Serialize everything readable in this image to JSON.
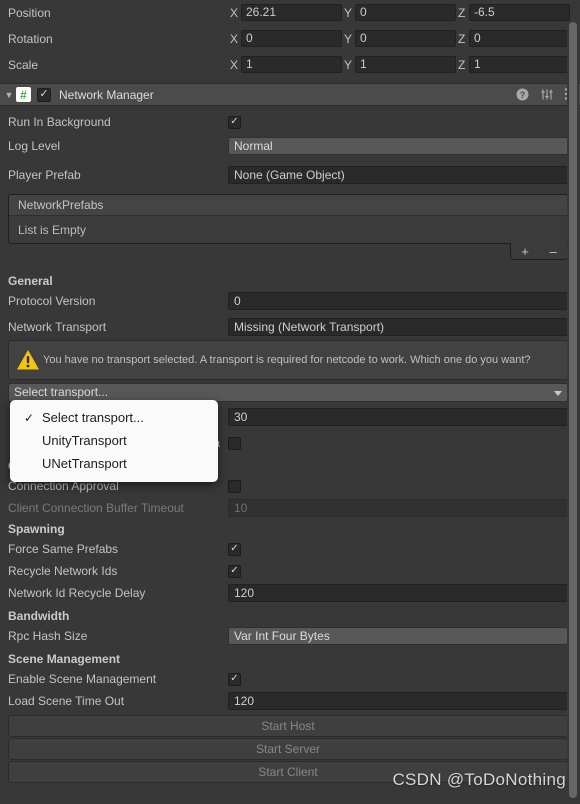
{
  "transform": {
    "rows": [
      {
        "label": "Position",
        "x": "26.21",
        "y": "0",
        "z": "-6.5"
      },
      {
        "label": "Rotation",
        "x": "0",
        "y": "0",
        "z": "0"
      },
      {
        "label": "Scale",
        "x": "1",
        "y": "1",
        "z": "1"
      }
    ],
    "axis_x": "X",
    "axis_y": "Y",
    "axis_z": "Z"
  },
  "component": {
    "title": "Network Manager",
    "script_icon_glyph": "#",
    "enabled_check": "✓",
    "foldout_glyph": "▼",
    "help_icon": "help-icon",
    "preset_icon": "preset-icon",
    "menu_icon": "more-menu-icon"
  },
  "fields": {
    "run_in_background": {
      "label": "Run In Background",
      "checked": true,
      "check": "✓"
    },
    "log_level": {
      "label": "Log Level",
      "value": "Normal"
    },
    "player_prefab": {
      "label": "Player Prefab",
      "value": "None (Game Object)"
    }
  },
  "network_prefabs_list": {
    "header": "NetworkPrefabs",
    "empty_text": "List is Empty",
    "add_label": "+",
    "remove_label": "–"
  },
  "general": {
    "title": "General",
    "protocol_version": {
      "label": "Protocol Version",
      "value": "0"
    },
    "network_transport": {
      "label": "Network Transport",
      "value": "Missing (Network Transport)"
    },
    "warning": "You have no transport selected. A transport is required for netcode to work. Which one do you want?",
    "select_transport_label": "Select transport...",
    "tick_rate_value": "30",
    "partial_label": "Sa"
  },
  "transport_menu": {
    "checkmark": "✓",
    "items": [
      {
        "label": "Select transport...",
        "selected": true
      },
      {
        "label": "UnityTransport",
        "selected": false
      },
      {
        "label": "UNetTransport",
        "selected": false
      }
    ]
  },
  "connection": {
    "title": "Connection",
    "connection_approval": {
      "label": "Connection Approval",
      "checked": false
    },
    "client_connection_buffer_timeout": {
      "label": "Client Connection Buffer Timeout",
      "value": "10",
      "disabled": true
    }
  },
  "spawning": {
    "title": "Spawning",
    "force_same_prefabs": {
      "label": "Force Same Prefabs",
      "checked": true,
      "check": "✓"
    },
    "recycle_network_ids": {
      "label": "Recycle Network Ids",
      "checked": true,
      "check": "✓"
    },
    "network_id_recycle_delay": {
      "label": "Network Id Recycle Delay",
      "value": "120"
    }
  },
  "bandwidth": {
    "title": "Bandwidth",
    "rpc_hash_size": {
      "label": "Rpc Hash Size",
      "value": "Var Int Four Bytes"
    }
  },
  "scene_management": {
    "title": "Scene Management",
    "enable_scene_management": {
      "label": "Enable Scene Management",
      "checked": true,
      "check": "✓"
    },
    "load_scene_time_out": {
      "label": "Load Scene Time Out",
      "value": "120"
    }
  },
  "buttons": {
    "start_host": "Start Host",
    "start_server": "Start Server",
    "start_client": "Start Client"
  },
  "watermark": "CSDN @ToDoNothing",
  "colors": {
    "background": "#383838",
    "header": "#4b4b4b",
    "field": "#2a2a2a",
    "popup": "#585858",
    "warning_yellow": "#f2c60f",
    "script_green": "#3eae4b",
    "menu_background": "#fafafa"
  }
}
